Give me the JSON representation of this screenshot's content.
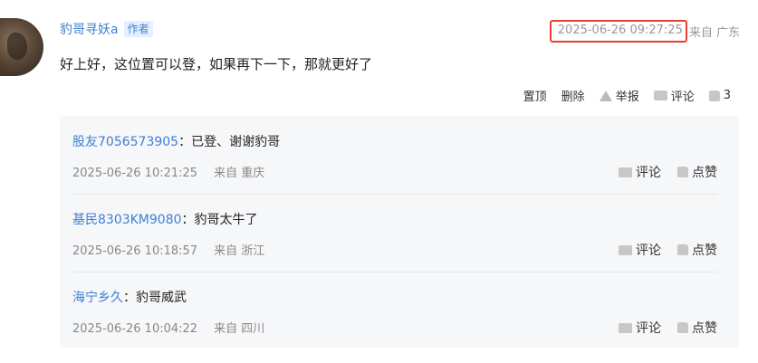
{
  "comment": {
    "author": "豹哥寻妖a",
    "author_badge": "作者",
    "time": "2025-06-26 09:27:25",
    "location": "来自 广东",
    "text": "好上好，这位置可以登，如果再下一下，那就更好了",
    "actions": {
      "pin": "置顶",
      "delete": "删除",
      "report": "举报",
      "reply": "评论",
      "like_count": "3"
    }
  },
  "replies": [
    {
      "user": "股友7056573905",
      "text": "：已登、谢谢豹哥",
      "time": "2025-06-26 10:21:25",
      "location": "来自 重庆",
      "reply_label": "评论",
      "like_label": "点赞"
    },
    {
      "user": "基民8303KM9080",
      "text": "：豹哥太牛了",
      "time": "2025-06-26 10:18:57",
      "location": "来自 浙江",
      "reply_label": "评论",
      "like_label": "点赞"
    },
    {
      "user": "海宁乡久",
      "text": "：豹哥威武",
      "time": "2025-06-26 10:04:22",
      "location": "来自 四川",
      "reply_label": "评论",
      "like_label": "点赞"
    }
  ],
  "colors": {
    "link": "#3e7fd6",
    "highlight_border": "#e8412f",
    "reply_bg": "#f6f7f9"
  }
}
